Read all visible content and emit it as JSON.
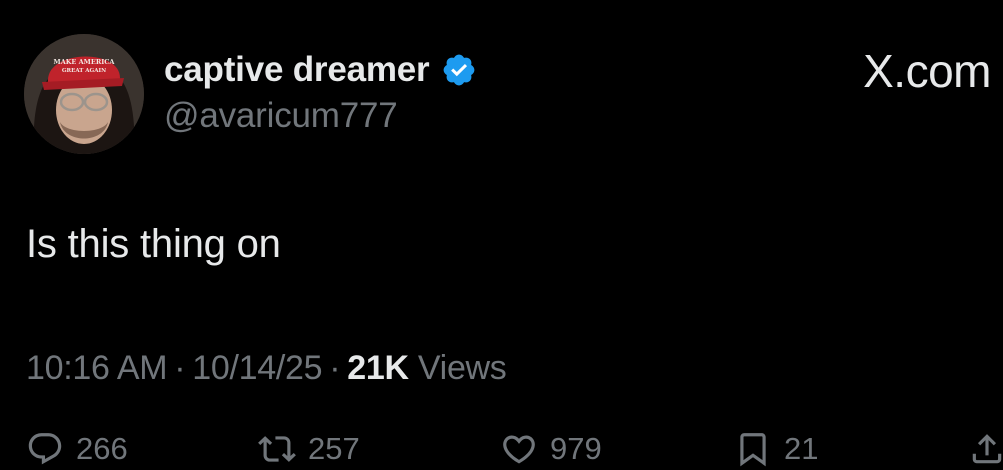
{
  "author": {
    "display_name": "captive dreamer",
    "handle": "@avaricum777",
    "verified": true,
    "avatar_icon": "profile-avatar",
    "avatar_hat_text_line1": "MAKE AMERICA",
    "avatar_hat_text_line2": "GREAT AGAIN"
  },
  "watermark": "X.com",
  "tweet": {
    "text": "Is this thing on"
  },
  "meta": {
    "time": "10:16 AM",
    "separator": "·",
    "date": "10/14/25",
    "views_count": "21K",
    "views_label": "Views"
  },
  "actions": {
    "replies": "266",
    "reposts": "257",
    "likes": "979",
    "bookmarks": "21",
    "icons": [
      "reply-icon",
      "repost-icon",
      "like-icon",
      "bookmark-icon",
      "share-icon"
    ]
  },
  "colors": {
    "background": "#000000",
    "primary_text": "#e7e9ea",
    "secondary_text": "#71767b",
    "verified_badge": "#1d9bf0"
  }
}
